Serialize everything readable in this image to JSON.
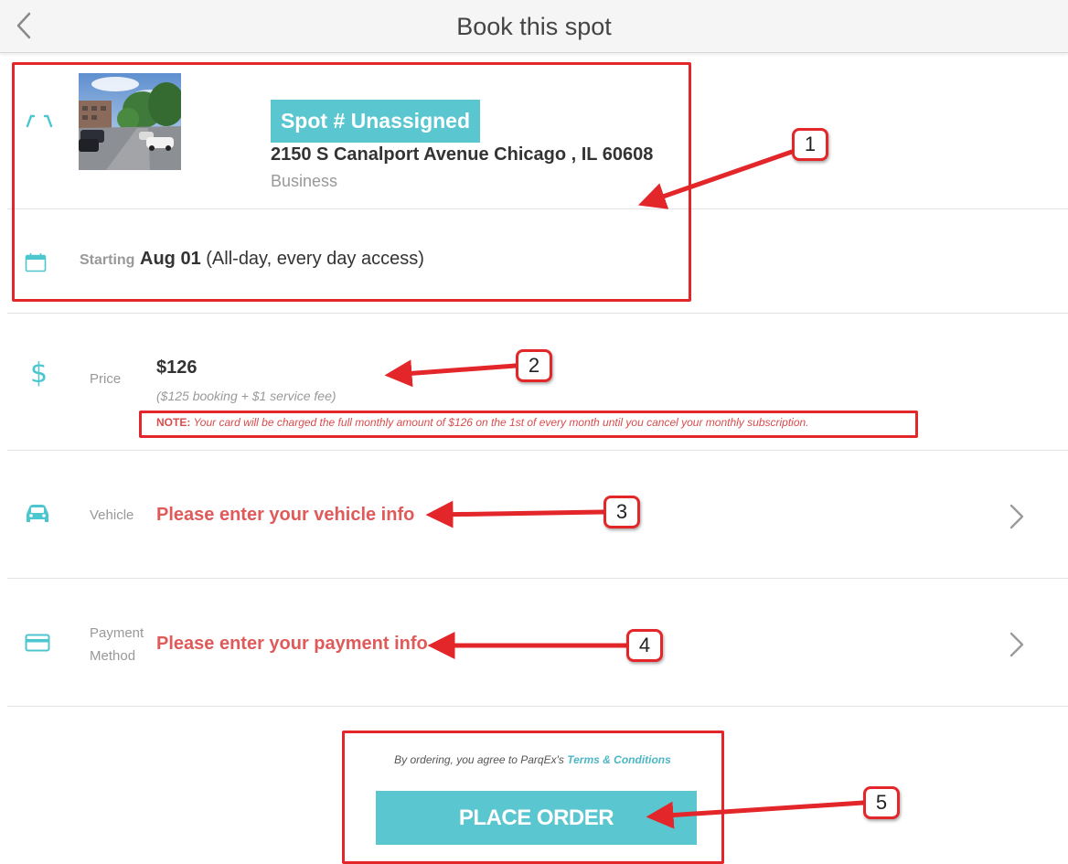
{
  "header": {
    "title": "Book this spot"
  },
  "spot": {
    "tag": "Spot # Unassigned",
    "address": "2150 S Canalport Avenue Chicago , IL 60608",
    "type": "Business"
  },
  "start": {
    "label": "Starting",
    "date": "Aug 01",
    "access": "(All-day, every day access)"
  },
  "price": {
    "label": "Price",
    "amount": "$126",
    "breakdown": "($125 booking + $1 service fee)",
    "note_label": "NOTE:",
    "note_text": "Your card will be charged the full monthly amount of $126 on the 1st of every month until you cancel your monthly subscription."
  },
  "vehicle": {
    "label": "Vehicle",
    "prompt": "Please enter your vehicle info"
  },
  "payment": {
    "label_line1": "Payment",
    "label_line2": "Method",
    "prompt": "Please enter your payment info"
  },
  "order": {
    "terms_text": "By ordering, you agree to ParqEx's",
    "terms_link": "Terms & Conditions",
    "button_label": "PLACE ORDER"
  },
  "annotations": {
    "badges": [
      "1",
      "2",
      "3",
      "4",
      "5"
    ]
  },
  "colors": {
    "accent": "#5ac6cf",
    "error": "#e05a5a",
    "annotation": "#e3262a"
  },
  "icons": {
    "back": "chevron-left-icon",
    "spot": "parking-spot-icon",
    "calendar": "calendar-icon",
    "price": "dollar-icon",
    "vehicle": "car-icon",
    "payment": "credit-card-icon",
    "row_chevron": "chevron-right-icon"
  }
}
